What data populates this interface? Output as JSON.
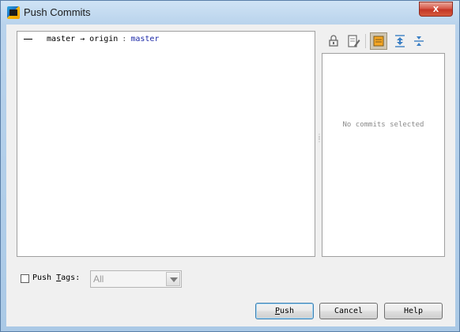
{
  "window": {
    "title": "Push Commits",
    "close_label": "x"
  },
  "push_tree": {
    "local_branch": "master",
    "arrow": "→",
    "remote": "origin",
    "separator": ":",
    "remote_branch": "master"
  },
  "details": {
    "empty_text": "No commits selected"
  },
  "toolbar": {
    "icons": [
      "commit-icon",
      "edit-icon",
      "preview-icon",
      "expand-all-icon",
      "collapse-all-icon"
    ],
    "active_icon": "preview-icon"
  },
  "tags": {
    "label_pre": "Push ",
    "label_mnemonic": "T",
    "label_post": "ags:",
    "checked": false,
    "select_value": "All"
  },
  "buttons": {
    "push_mnemonic": "P",
    "push_rest": "ush",
    "cancel": "Cancel",
    "help": "Help"
  },
  "colors": {
    "accent": "#1d2aa8",
    "close": "#c33626"
  }
}
